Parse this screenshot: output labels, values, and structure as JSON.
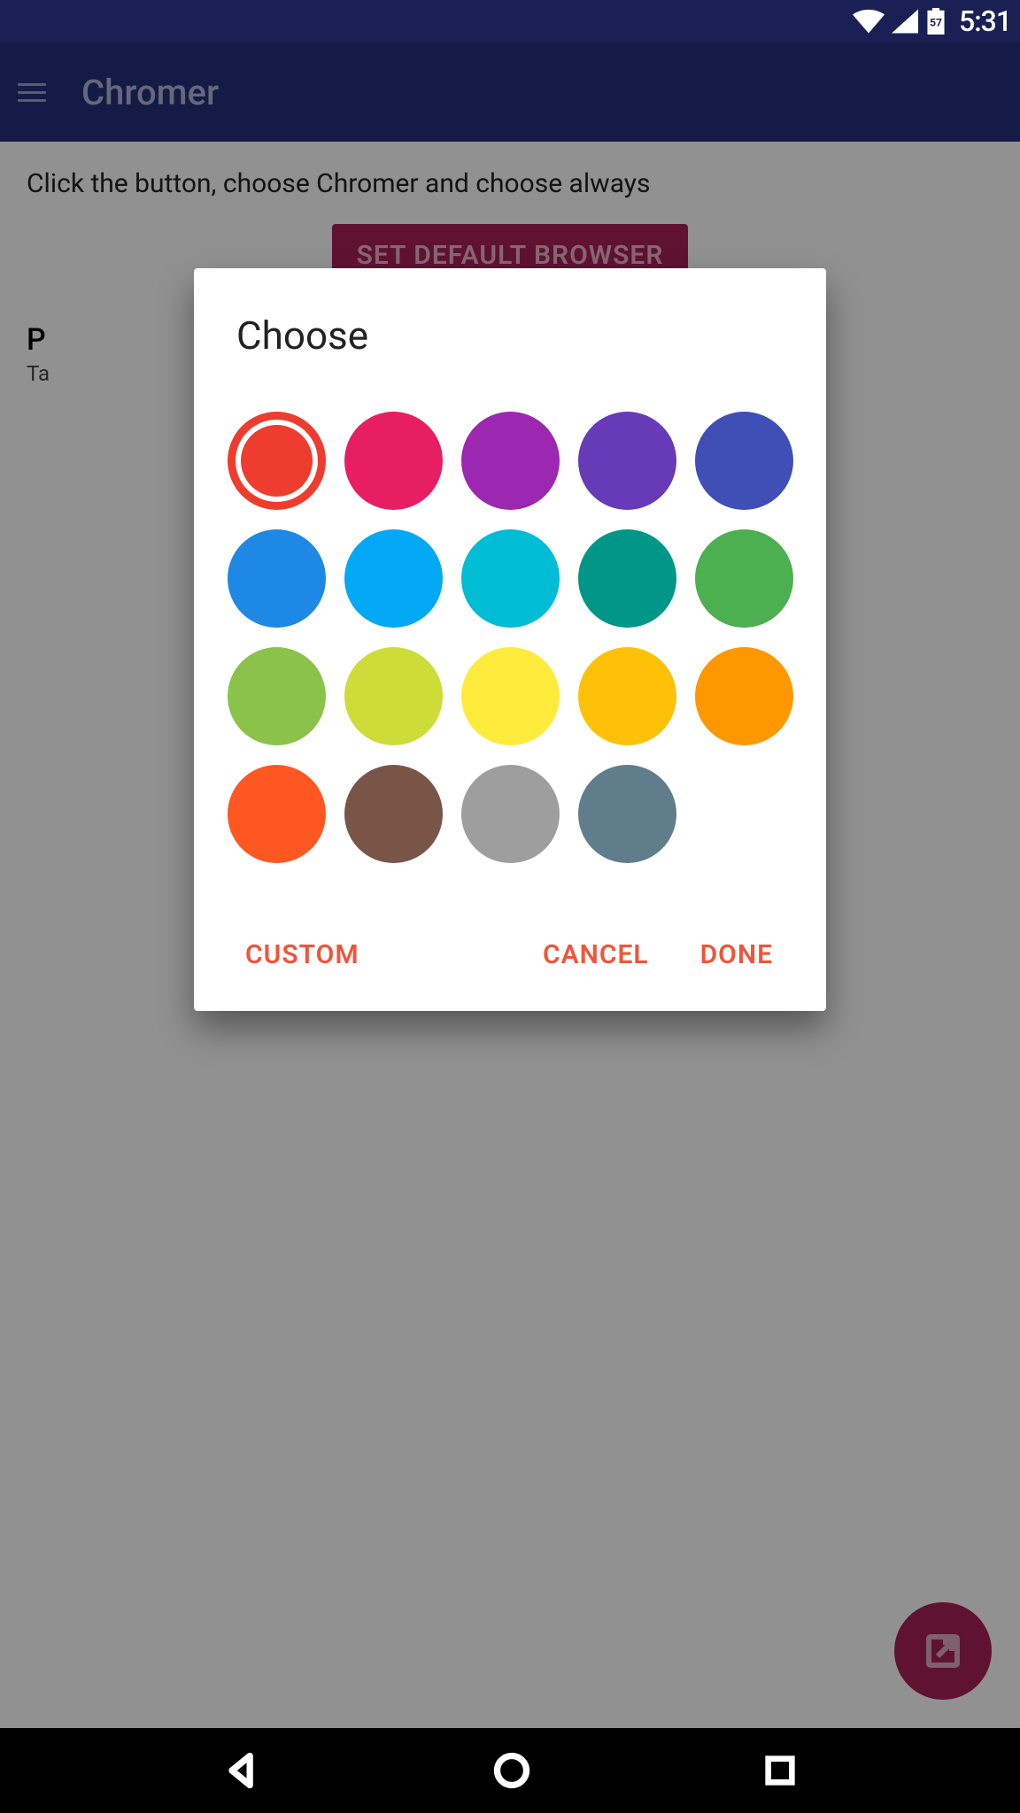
{
  "status": {
    "time": "5:31",
    "battery_text": "57"
  },
  "app": {
    "title": "Chromer"
  },
  "main": {
    "instruction": "Click the button, choose Chromer and choose always",
    "set_default_button": "SET DEFAULT BROWSER",
    "pref_title_initial": "P",
    "pref_sub_initial": "Ta"
  },
  "dialog": {
    "title": "Choose",
    "selected_index": 0,
    "colors": [
      "#ee3c2f",
      "#e81e63",
      "#9c27b0",
      "#673ab7",
      "#3f4fb5",
      "#1e88e5",
      "#03a9f4",
      "#00bcd4",
      "#009688",
      "#4caf50",
      "#8bc34a",
      "#cddc39",
      "#ffeb3b",
      "#ffc107",
      "#ff9800",
      "#ff5722",
      "#795548",
      "#9e9e9e",
      "#607d8b"
    ],
    "buttons": {
      "custom": "CUSTOM",
      "cancel": "CANCEL",
      "done": "DONE"
    }
  }
}
